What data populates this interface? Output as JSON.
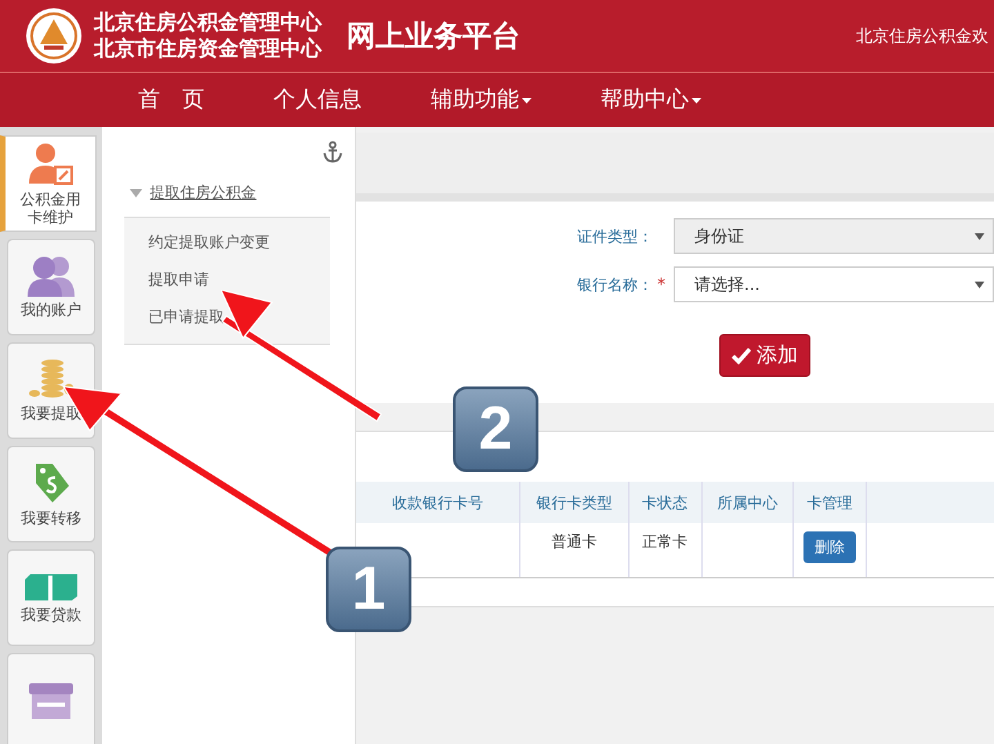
{
  "header": {
    "org_lines": [
      "北京住房公积金管理中心",
      "北京市住房资金管理中心"
    ],
    "platform": "网上业务平台",
    "welcome": "北京住房公积金欢"
  },
  "nav": [
    {
      "label": "首　页",
      "dropdown": false
    },
    {
      "label": "个人信息",
      "dropdown": false
    },
    {
      "label": "辅助功能",
      "dropdown": true
    },
    {
      "label": "帮助中心",
      "dropdown": true
    }
  ],
  "sidebar": {
    "items": [
      {
        "kind": "user-edit",
        "label": "公积金用卡维护",
        "selected": true
      },
      {
        "kind": "users",
        "label": "我的账户",
        "selected": false
      },
      {
        "kind": "coins",
        "label": "我要提取",
        "selected": false
      },
      {
        "kind": "tag",
        "label": "我要转移",
        "selected": false
      },
      {
        "kind": "money",
        "label": "我要贷款",
        "selected": false
      },
      {
        "kind": "shop",
        "selected": false
      }
    ]
  },
  "submenu": {
    "group": "提取住房公积金",
    "expanded": true,
    "items": [
      "约定提取账户变更",
      "提取申请",
      "已申请提取"
    ]
  },
  "form": {
    "fields": [
      {
        "label": "证件类型：",
        "disabled": true,
        "value": "身份证"
      },
      {
        "label": "银行名称：",
        "required_mark": "*",
        "disabled": false,
        "value": "请选择..."
      }
    ],
    "add_button": "添加"
  },
  "table": {
    "columns": [
      "收款银行卡号",
      "银行卡类型",
      "卡状态",
      "所属中心",
      "卡管理"
    ],
    "rows": [
      {
        "cells": [
          "",
          "普通卡",
          "正常卡",
          ""
        ],
        "action": "删除"
      }
    ]
  },
  "annotations": [
    {
      "label": "2"
    },
    {
      "label": "1"
    }
  ]
}
